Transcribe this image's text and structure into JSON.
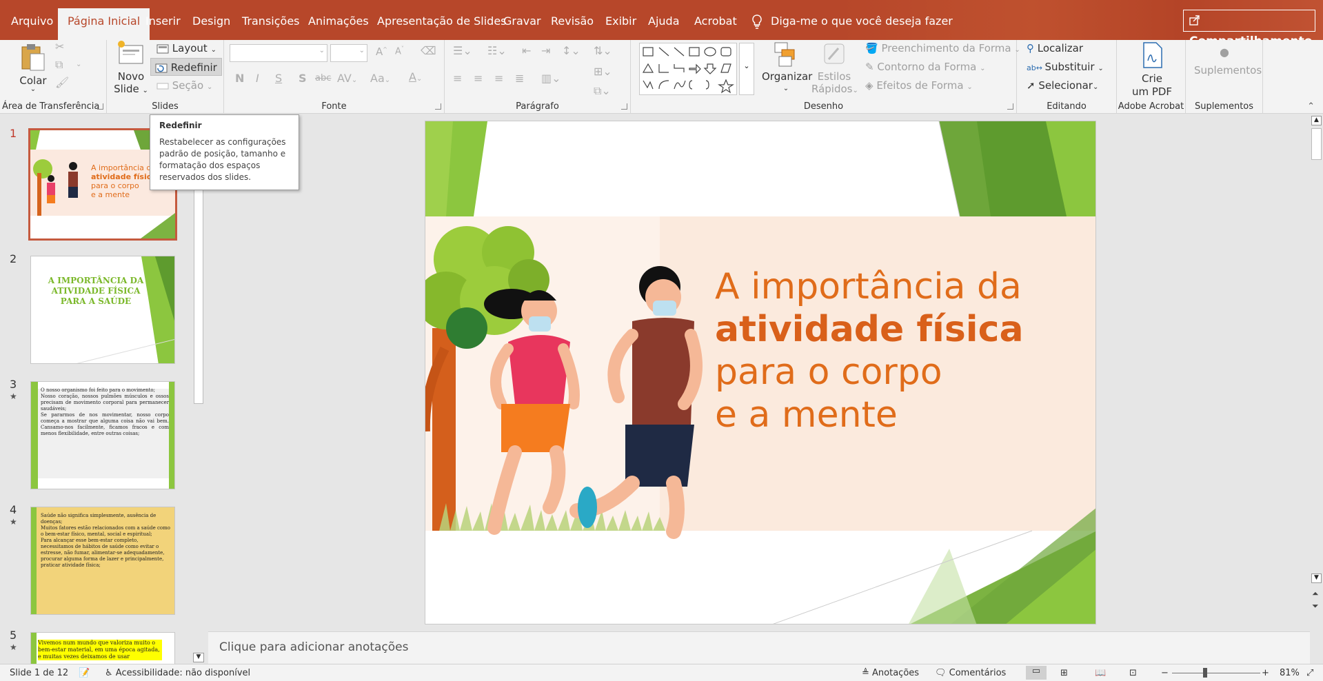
{
  "tabs": [
    "Arquivo",
    "Página Inicial",
    "Inserir",
    "Design",
    "Transições",
    "Animações",
    "Apresentação de Slides",
    "Gravar",
    "Revisão",
    "Exibir",
    "Ajuda",
    "Acrobat"
  ],
  "active_tab": "Página Inicial",
  "tell_me": "Diga-me o que você deseja fazer",
  "share_label": "Compartilhamento",
  "ribbon": {
    "clipboard": {
      "paste": "Colar",
      "group": "Área de Transferência"
    },
    "slides": {
      "new_slide_1": "Novo",
      "new_slide_2": "Slide",
      "layout": "Layout",
      "reset": "Redefinir",
      "section": "Seção",
      "group": "Slides"
    },
    "font": {
      "group": "Fonte",
      "bold": "N",
      "italic": "I",
      "underline": "S",
      "shadow": "S",
      "strike": "abc",
      "spacing": "AV",
      "case": "Aa",
      "color": "A"
    },
    "paragraph": {
      "group": "Parágrafo"
    },
    "drawing": {
      "arrange": "Organizar",
      "quick_styles_1": "Estilos",
      "quick_styles_2": "Rápidos",
      "shape_fill": "Preenchimento da Forma",
      "shape_outline": "Contorno da Forma",
      "shape_effects": "Efeitos de Forma",
      "group": "Desenho"
    },
    "editing": {
      "find": "Localizar",
      "replace": "Substituir",
      "select": "Selecionar",
      "group": "Editando"
    },
    "acrobat": {
      "create_pdf_1": "Crie",
      "create_pdf_2": "um PDF",
      "group": "Adobe Acrobat"
    },
    "addins": {
      "label": "Suplementos",
      "group": "Suplementos"
    }
  },
  "tooltip": {
    "title": "Redefinir",
    "body": "Restabelecer as configurações padrão de posição, tamanho e formatação dos espaços reservados dos slides."
  },
  "thumbnails": [
    {
      "num": "1",
      "line1": "A importância da",
      "line2": "atividade física",
      "line3": "para o corpo",
      "line4": "e a mente"
    },
    {
      "num": "2",
      "title": "A IMPORTÂNCIA DA ATIVIDADE FÍSICA PARA A SAÚDE"
    },
    {
      "num": "3",
      "bullets": [
        "O nosso organismo foi feito para o movimento;",
        "Nosso coração, nossos pulmões músculos e ossos precisam de movimento corporal para permanecer saudáveis;",
        "Se pararmos de nos movimentar, nosso corpo começa a mostrar que alguma coisa não vai bem. Cansamo-nos facilmente, ficamos fracos e com menos flexibilidade, entre outras coisas;"
      ]
    },
    {
      "num": "4",
      "bullets": [
        "Saúde não significa simplesmente, ausência de doenças;",
        "Muitos fatores estão relacionados com a saúde como o bem-estar físico, mental, social e espiritual;",
        "Para alcançar esse bem-estar completo, necessitamos de hábitos de saúde como evitar o estresse, não fumar, alimentar-se adequadamente, procurar alguma forma de lazer e principalmente, praticar atividade física;"
      ]
    },
    {
      "num": "5",
      "bullets": [
        "Vivemos num mundo que valoriza muito o bem-estar material, em uma época agitada, e muitas vezes deixamos de usar"
      ]
    }
  ],
  "slide": {
    "line1": "A importância da",
    "line2": "atividade física",
    "line3": "para o corpo",
    "line4": "e a mente"
  },
  "notes_placeholder": "Clique para adicionar anotações",
  "status": {
    "slide_info": "Slide 1 de 12",
    "accessibility": "Acessibilidade: não disponível",
    "notes": "Anotações",
    "comments": "Comentários",
    "zoom": "81%"
  },
  "colors": {
    "accent": "#b7472a",
    "title_orange": "#e06c1a",
    "green": "#8cc63f"
  }
}
